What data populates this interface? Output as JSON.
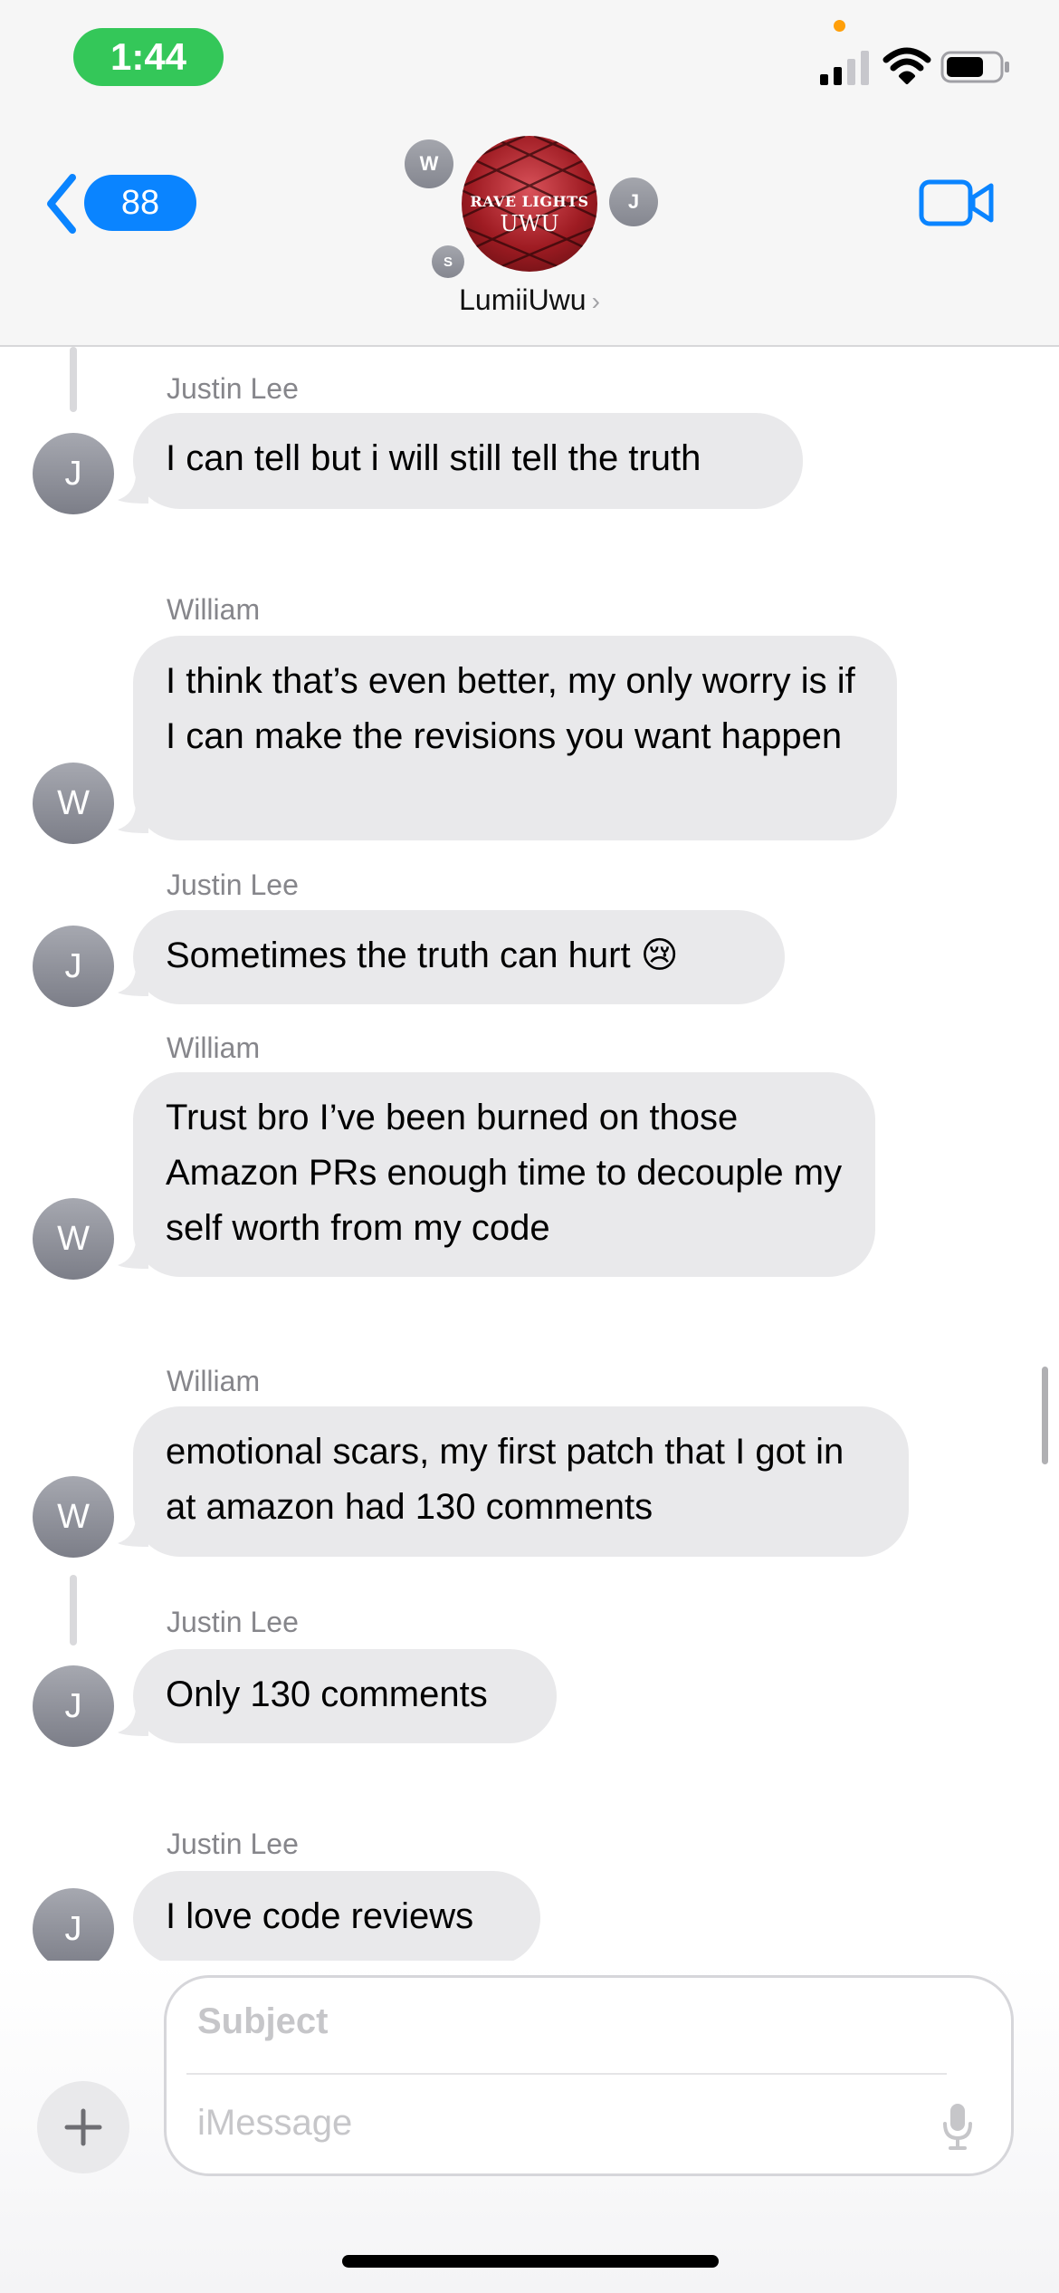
{
  "status_bar": {
    "time": "1:44"
  },
  "header": {
    "back_badge_count": "88",
    "group_name": "LumiiUwu",
    "group_name_chevron": "›",
    "group_avatar_text_line1": "RAVE LIGHTS",
    "group_avatar_text_line2": "UWU",
    "member_initials": [
      "W",
      "J",
      "S"
    ]
  },
  "messages": [
    {
      "sender": "Justin Lee",
      "initial": "J",
      "text": "I can tell but i will still tell the truth"
    },
    {
      "sender": "William",
      "initial": "W",
      "text": "I think that’s even better, my only worry is if I can make the revisions you want happen"
    },
    {
      "sender": "Justin Lee",
      "initial": "J",
      "text": "Sometimes the truth can hurt 😢"
    },
    {
      "sender": "William",
      "initial": "W",
      "text": "Trust bro I’ve been burned on those Amazon PRs enough time to decouple my self worth from my code"
    },
    {
      "sender": "William",
      "initial": "W",
      "text": "emotional scars, my first patch that I got in at amazon had 130 comments"
    },
    {
      "sender": "Justin Lee",
      "initial": "J",
      "text": "Only 130 comments"
    },
    {
      "sender": "Justin Lee",
      "initial": "J",
      "text": "I love code reviews"
    }
  ],
  "composer": {
    "subject_placeholder": "Subject",
    "message_placeholder": "iMessage"
  },
  "colors": {
    "accent": "#0a84ff",
    "status_pill": "#34c759",
    "bubble": "#e9e9eb",
    "sender_label": "#86868b"
  },
  "icons": [
    "back-chevron-icon",
    "video-camera-icon",
    "plus-icon",
    "microphone-icon",
    "signal-icon",
    "wifi-icon",
    "battery-icon"
  ]
}
